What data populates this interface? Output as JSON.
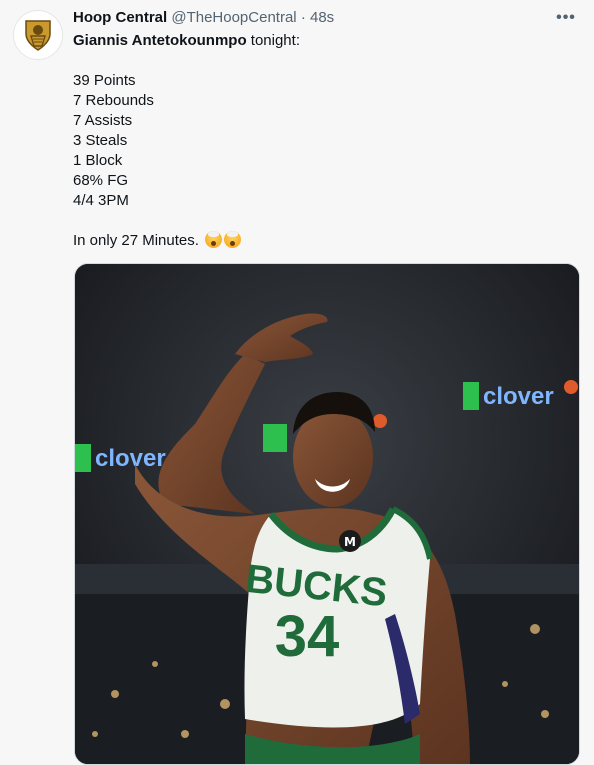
{
  "author": {
    "display_name": "Hoop Central",
    "handle": "@TheHoopCentral",
    "separator": "·",
    "time": "48s",
    "avatar_icon": "hoop-central-crest-logo"
  },
  "actions": {
    "more_icon": "more-dots-icon",
    "more_label": "•••"
  },
  "tweet": {
    "headline_name": "Giannis Antetokounmpo",
    "headline_rest": " tonight:",
    "stats": [
      "39 Points",
      "7 Rebounds",
      "7 Assists",
      "3 Steals",
      "1 Block",
      "68% FG",
      "4/4 3PM"
    ],
    "closing": "In only 27 Minutes.",
    "closing_emojis": [
      "exploding-head-emoji",
      "exploding-head-emoji"
    ]
  },
  "media": {
    "jersey_text": "BUCKS",
    "jersey_number": "34",
    "signage_text": "clover",
    "colors": {
      "jersey": "#eef0ec",
      "jersey_green": "#1f6b3a",
      "jersey_trim": "#2b2a6b",
      "arena": "#1d1f24",
      "sign_green": "#2ec04f"
    }
  }
}
